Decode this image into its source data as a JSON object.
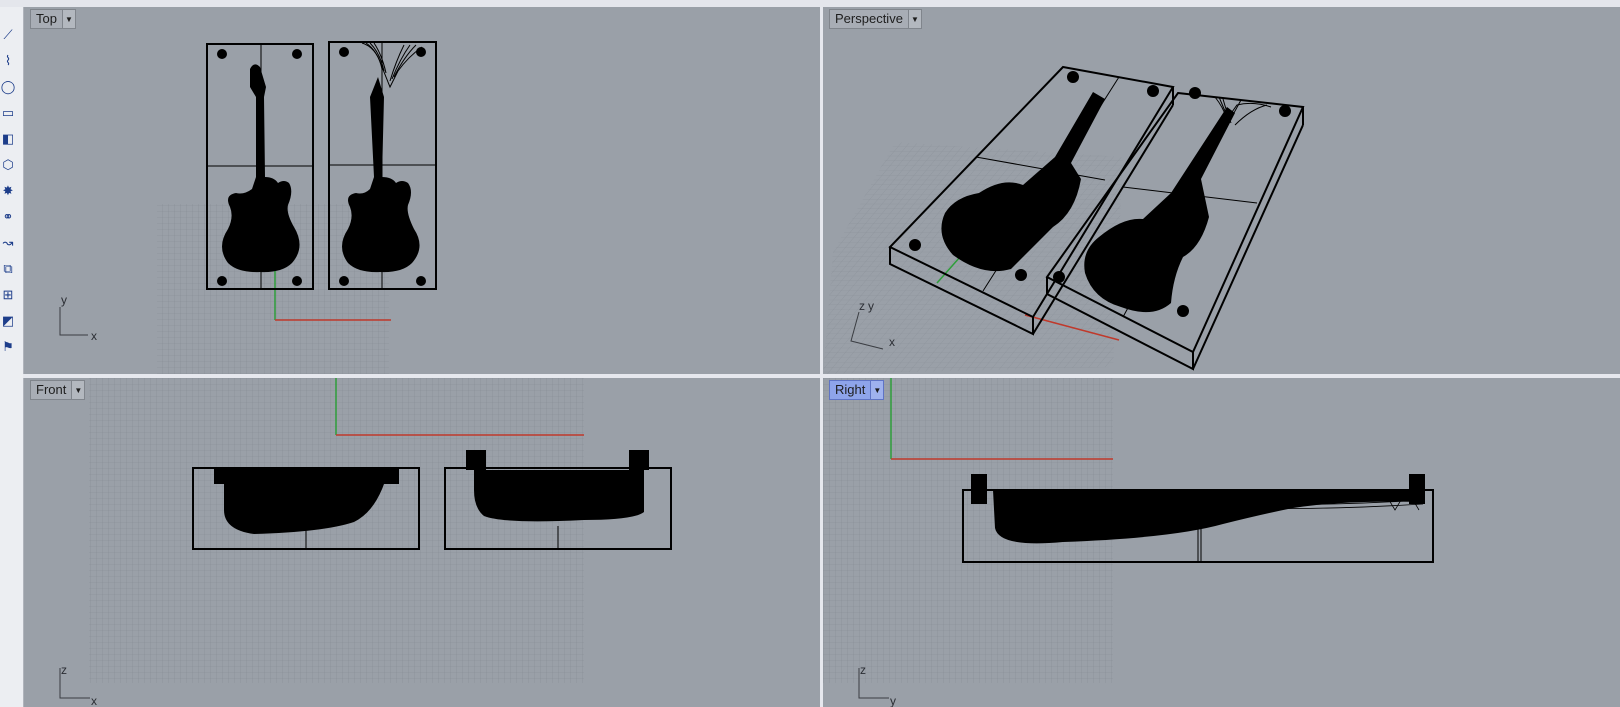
{
  "viewports": {
    "top": {
      "label": "Top",
      "axis_x": "x",
      "axis_y": "y"
    },
    "perspective": {
      "label": "Perspective",
      "axis_x": "x",
      "axis_y": "y",
      "axis_z": "z"
    },
    "front": {
      "label": "Front",
      "axis_x": "x",
      "axis_z": "z"
    },
    "right": {
      "label": "Right",
      "axis_y": "y",
      "axis_z": "z"
    }
  },
  "toolbar": {
    "tools": [
      {
        "icon": "line-tool-icon",
        "glyph": "⟋"
      },
      {
        "icon": "polyline-tool-icon",
        "glyph": "⌇"
      },
      {
        "icon": "circle-tool-icon",
        "glyph": "◯"
      },
      {
        "icon": "rectangle-tool-icon",
        "glyph": "▭"
      },
      {
        "icon": "surface-tool-icon",
        "glyph": "◧"
      },
      {
        "icon": "solid-tool-icon",
        "glyph": "⬡"
      },
      {
        "icon": "explode-tool-icon",
        "glyph": "✸"
      },
      {
        "icon": "boolean-tool-icon",
        "glyph": "⚭"
      },
      {
        "icon": "curve-edit-tool-icon",
        "glyph": "↝"
      },
      {
        "icon": "transform-tool-icon",
        "glyph": "⧉"
      },
      {
        "icon": "dimension-tool-icon",
        "glyph": "⊞"
      },
      {
        "icon": "analyze-tool-icon",
        "glyph": "◩"
      },
      {
        "icon": "render-tool-icon",
        "glyph": "⚑"
      }
    ]
  },
  "colors": {
    "viewport_bg": "#9aa0a8",
    "grid": "#868c94",
    "x_axis": "#c0392b",
    "y_axis": "#2e9e3a",
    "active_label": "#8ea4ea"
  }
}
